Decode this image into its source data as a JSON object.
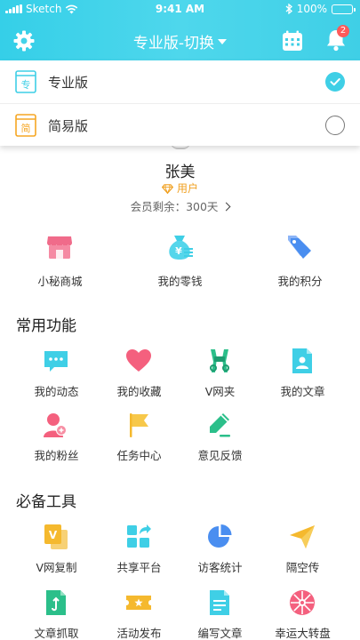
{
  "status_bar": {
    "carrier": "Sketch",
    "time": "9:41 AM",
    "battery": "100%"
  },
  "nav": {
    "title": "专业版-切换",
    "notification_count": "2"
  },
  "version_menu": {
    "items": [
      {
        "icon_text": "专",
        "label": "专业版",
        "selected": true,
        "icon": "pro-edition-icon"
      },
      {
        "icon_text": "简",
        "label": "简易版",
        "selected": false,
        "icon": "simple-edition-icon"
      }
    ]
  },
  "profile": {
    "name": "张美",
    "role": "用户",
    "membership": "会员剩余：300天"
  },
  "wallet": [
    {
      "label": "小秘商城",
      "icon": "shop-icon"
    },
    {
      "label": "我的零钱",
      "icon": "money-bag-icon"
    },
    {
      "label": "我的积分",
      "icon": "points-tag-icon"
    }
  ],
  "common_functions": {
    "title": "常用功能",
    "items": [
      {
        "label": "我的动态",
        "icon": "chat-bubble-icon"
      },
      {
        "label": "我的收藏",
        "icon": "heart-icon"
      },
      {
        "label": "V网夹",
        "icon": "binder-clip-icon"
      },
      {
        "label": "我的文章",
        "icon": "article-icon"
      },
      {
        "label": "我的粉丝",
        "icon": "fans-icon"
      },
      {
        "label": "任务中心",
        "icon": "flag-icon"
      },
      {
        "label": "意见反馈",
        "icon": "pen-icon"
      }
    ]
  },
  "tools": {
    "title": "必备工具",
    "items": [
      {
        "label": "V网复制",
        "icon": "copy-icon"
      },
      {
        "label": "共享平台",
        "icon": "share-platform-icon"
      },
      {
        "label": "访客统计",
        "icon": "pie-chart-icon"
      },
      {
        "label": "隔空传",
        "icon": "paper-plane-icon"
      },
      {
        "label": "文章抓取",
        "icon": "article-grab-icon"
      },
      {
        "label": "活动发布",
        "icon": "ticket-icon"
      },
      {
        "label": "编写文章",
        "icon": "write-article-icon"
      },
      {
        "label": "幸运大转盘",
        "icon": "lucky-wheel-icon"
      }
    ]
  },
  "colors": {
    "accent": "#3fcfe6",
    "badge": "#ff5a5a",
    "role": "#f0a020"
  }
}
